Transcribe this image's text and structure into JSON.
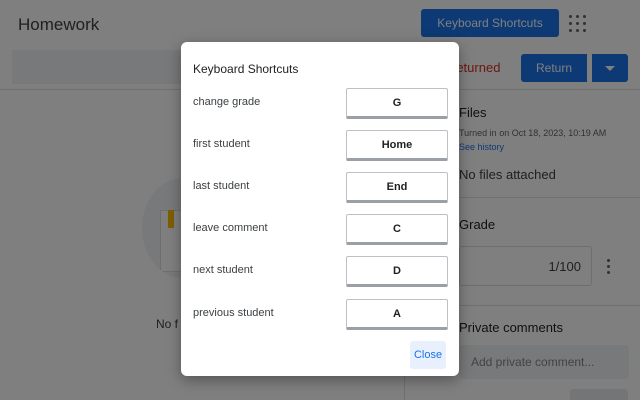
{
  "app": {
    "title": "Homework",
    "keyboard_shortcuts_button": "Keyboard Shortcuts",
    "apps_icon": "apps-grid-icon"
  },
  "submission": {
    "status": "returned",
    "return_button": "Return",
    "return_dropdown_icon": "caret-down-icon"
  },
  "main": {
    "no_files_partial": "No f"
  },
  "sidebar": {
    "files_title": "Files",
    "turned_in": "Turned in on Oct 18, 2023, 10:19 AM",
    "see_history": "See history",
    "no_files": "No files attached",
    "grade_title": "Grade",
    "grade_value": "1/100",
    "more_icon": "more-vert-icon",
    "private_comments_title": "Private comments",
    "comment_placeholder": "Add private comment..."
  },
  "dialog": {
    "title": "Keyboard Shortcuts",
    "shortcuts": [
      {
        "action": "change grade",
        "key": "G"
      },
      {
        "action": "first student",
        "key": "Home"
      },
      {
        "action": "last student",
        "key": "End"
      },
      {
        "action": "leave comment",
        "key": "C"
      },
      {
        "action": "next student",
        "key": "D"
      },
      {
        "action": "previous student",
        "key": "A"
      }
    ],
    "close_button": "Close"
  },
  "colors": {
    "accent": "#1a73e8",
    "status_returned": "#d93025",
    "scrim": "rgba(0,0,0,0.5)"
  }
}
